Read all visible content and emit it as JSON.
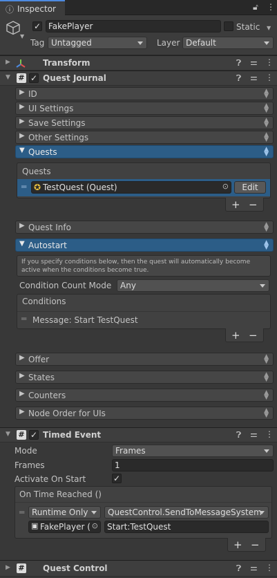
{
  "tab": {
    "title": "Inspector"
  },
  "gameobject": {
    "name": "FakePlayer",
    "static_label": "Static",
    "tag_label": "Tag",
    "tag_value": "Untagged",
    "layer_label": "Layer",
    "layer_value": "Default"
  },
  "transform": {
    "title": "Transform"
  },
  "quest_journal": {
    "title": "Quest Journal",
    "sections": {
      "id": "ID",
      "ui_settings": "UI Settings",
      "save_settings": "Save Settings",
      "other_settings": "Other Settings",
      "quests": "Quests",
      "quest_info": "Quest Info",
      "autostart": "Autostart",
      "offer": "Offer",
      "states": "States",
      "counters": "Counters",
      "node_order": "Node Order for UIs"
    },
    "quests_list": {
      "header": "Quests",
      "items": [
        {
          "value": "TestQuest (Quest)",
          "edit_label": "Edit"
        }
      ]
    },
    "autostart": {
      "help_text": "If you specify conditions below, then the quest will automatically become active when the conditions become true.",
      "condition_count_mode_label": "Condition Count Mode",
      "condition_count_mode_value": "Any",
      "conditions_header": "Conditions",
      "conditions": [
        "Message: Start TestQuest"
      ]
    }
  },
  "timed_event": {
    "title": "Timed Event",
    "mode_label": "Mode",
    "mode_value": "Frames",
    "frames_label": "Frames",
    "frames_value": "1",
    "activate_label": "Activate On Start",
    "event_header": "On Time Reached ()",
    "runtime_value": "Runtime Only",
    "function_value": "QuestControl.SendToMessageSystem",
    "object_value": "FakePlayer (",
    "argument_value": "Start:TestQuest"
  },
  "quest_control": {
    "title": "Quest Control"
  },
  "controls": {
    "plus": "+",
    "minus": "−",
    "check": "✓"
  },
  "colors": {
    "accent": "#2c5d87",
    "background": "#383838"
  }
}
